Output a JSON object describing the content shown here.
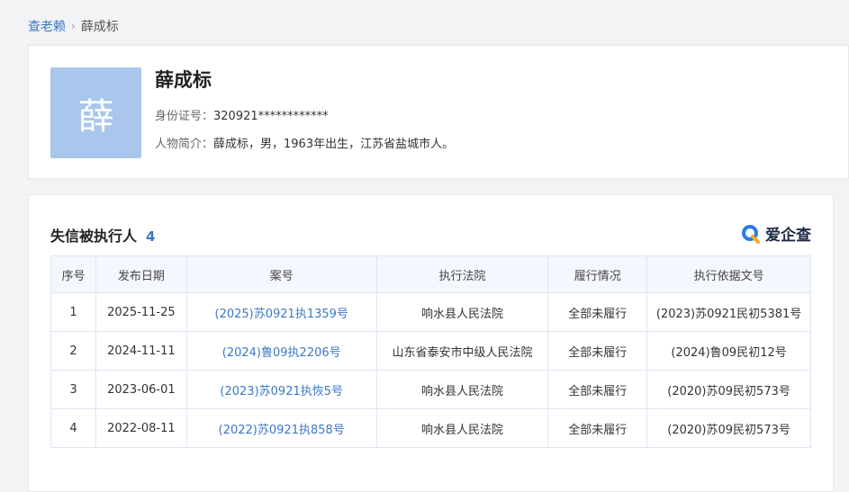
{
  "breadcrumb": {
    "root": "查老赖",
    "current": "薛成标"
  },
  "profile": {
    "avatar_char": "薛",
    "name": "薛成标",
    "id_label": "身份证号：",
    "id_value": "320921************",
    "intro_label": "人物简介：",
    "intro_value": "薛成标，男，1963年出生，江苏省盐城市人。"
  },
  "list": {
    "title": "失信被执行人",
    "count": "4",
    "brand": "爱企查",
    "columns": [
      "序号",
      "发布日期",
      "案号",
      "执行法院",
      "履行情况",
      "执行依据文号"
    ],
    "rows": [
      {
        "index": "1",
        "date": "2025-11-25",
        "case_no": "(2025)苏0921执1359号",
        "court": "响水县人民法院",
        "status": "全部未履行",
        "basis": "(2023)苏0921民初5381号"
      },
      {
        "index": "2",
        "date": "2024-11-11",
        "case_no": "(2024)鲁09执2206号",
        "court": "山东省泰安市中级人民法院",
        "status": "全部未履行",
        "basis": "(2024)鲁09民初12号"
      },
      {
        "index": "3",
        "date": "2023-06-01",
        "case_no": "(2023)苏0921执恢5号",
        "court": "响水县人民法院",
        "status": "全部未履行",
        "basis": "(2020)苏09民初573号"
      },
      {
        "index": "4",
        "date": "2022-08-11",
        "case_no": "(2022)苏0921执858号",
        "court": "响水县人民法院",
        "status": "全部未履行",
        "basis": "(2020)苏09民初573号"
      }
    ]
  },
  "colors": {
    "accent": "#3b78c4",
    "avatar_bg": "#a9c7ec",
    "header_bg": "#f4f7fd"
  }
}
